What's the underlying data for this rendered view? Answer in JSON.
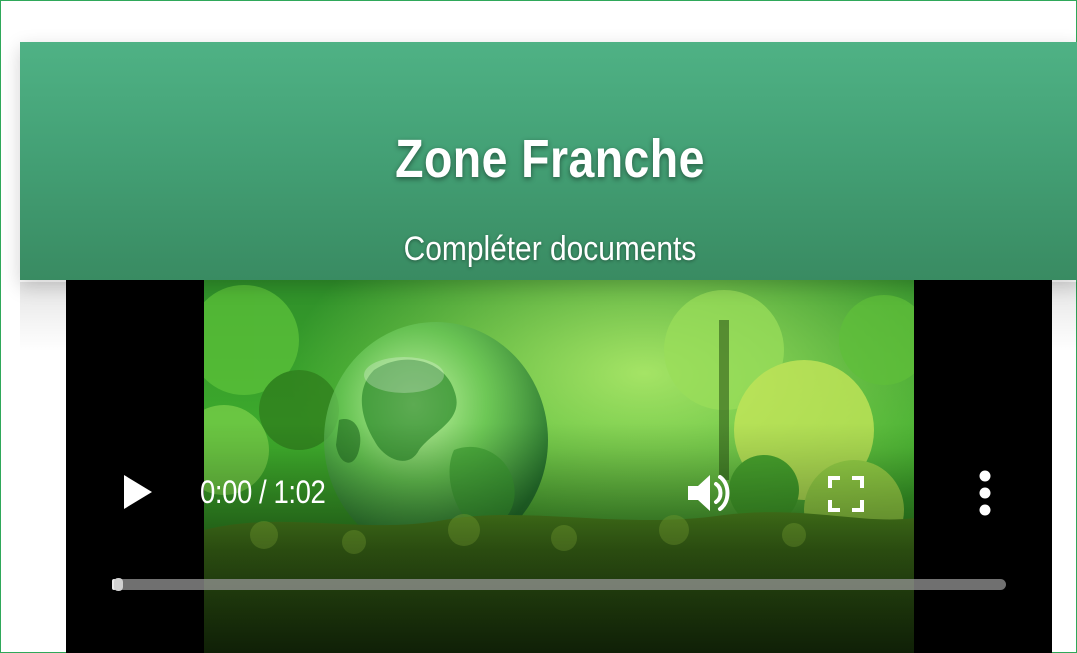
{
  "header": {
    "title": "Zone Franche",
    "subtitle": "Compléter documents"
  },
  "video": {
    "time_display": "0:00 / 1:02",
    "progress": 0.005,
    "icons": {
      "play": "play-icon",
      "volume": "volume-icon",
      "fullscreen": "fullscreen-icon",
      "more": "more-vertical-icon"
    }
  },
  "colors": {
    "header_top": "#4fb285",
    "header_bottom": "#398b62",
    "frame_border": "#2fa85a",
    "player_bg": "#000000"
  }
}
